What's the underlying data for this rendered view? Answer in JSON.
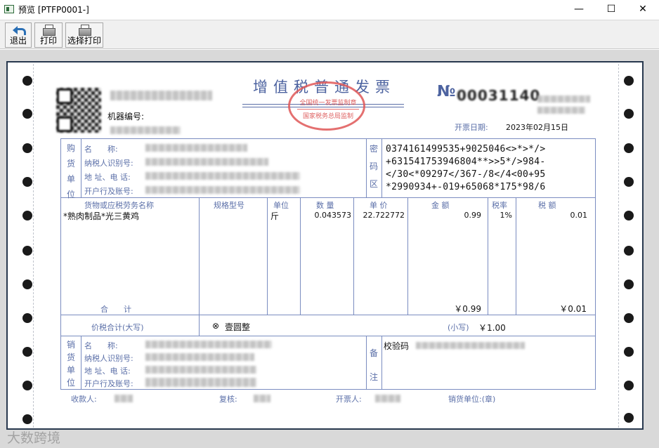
{
  "window": {
    "title": "预览 [PTFP0001-]",
    "minimize": "—",
    "maximize": "☐",
    "close": "✕"
  },
  "toolbar": {
    "exit_label": "退出",
    "print_label": "打印",
    "select_print_label": "选择打印"
  },
  "invoice": {
    "title": "增值税普通发票",
    "seal_top": "全国统一发票监制章",
    "seal_bottom": "国家税务总局监制",
    "machine_no_label": "机器编号:",
    "no_mark": "№",
    "no_value": "00031140",
    "issue_date_label": "开票日期:",
    "issue_date": "2023年02月15日",
    "buyer": {
      "section_label": [
        "购",
        "货",
        "单",
        "位"
      ],
      "name_label": "名　　称:",
      "tax_id_label": "纳税人识别号:",
      "address_label": "地 址、电 话:",
      "bank_label": "开户行及账号:"
    },
    "password_area": {
      "section_label": [
        "密",
        "码",
        "区"
      ],
      "lines": [
        "0374161499535+9025046<>*>*/>",
        "+631541753946804**>>5*/>984-",
        "</30<*09297</367-/8</4<00+95",
        "*2990934+-019+65068*175*98/6"
      ]
    },
    "columns": {
      "item": "货物或应税劳务名称",
      "spec": "规格型号",
      "unit": "单位",
      "qty": "数 量",
      "price": "单 价",
      "amount": "金 额",
      "rate": "税率",
      "tax": "税 额"
    },
    "items": [
      {
        "name": "*熟肉制品*光三黄鸡",
        "spec": "",
        "unit": "斤",
        "qty": "0.043573",
        "price": "22.722772",
        "amount": "0.99",
        "rate": "1%",
        "tax": "0.01"
      }
    ],
    "subtotal_label": "合　　计",
    "subtotal_amount": "￥0.99",
    "subtotal_tax": "￥0.01",
    "total_label": "价税合计(大写)",
    "total_words_icon": "⊗",
    "total_words": "壹圆整",
    "total_small_label": "(小写)",
    "total_small": "￥1.00",
    "seller": {
      "section_label": [
        "销",
        "货",
        "单",
        "位"
      ],
      "name_label": "名　　称:",
      "tax_id_label": "纳税人识别号:",
      "address_label": "地 址、电 话:",
      "bank_label": "开户行及账号:"
    },
    "remarks": {
      "section_label": [
        "备",
        "注"
      ],
      "check_code_label": "校验码"
    },
    "footer": {
      "payee_label": "收款人:",
      "reviewer_label": "复核:",
      "issuer_label": "开票人:",
      "seller_stamp_label": "销货单位:(章)"
    }
  },
  "watermark": "大数跨境",
  "colors": {
    "invoice_blue": "#5b6fa8",
    "seal_red": "#e05858",
    "paper_border": "#28384e"
  }
}
